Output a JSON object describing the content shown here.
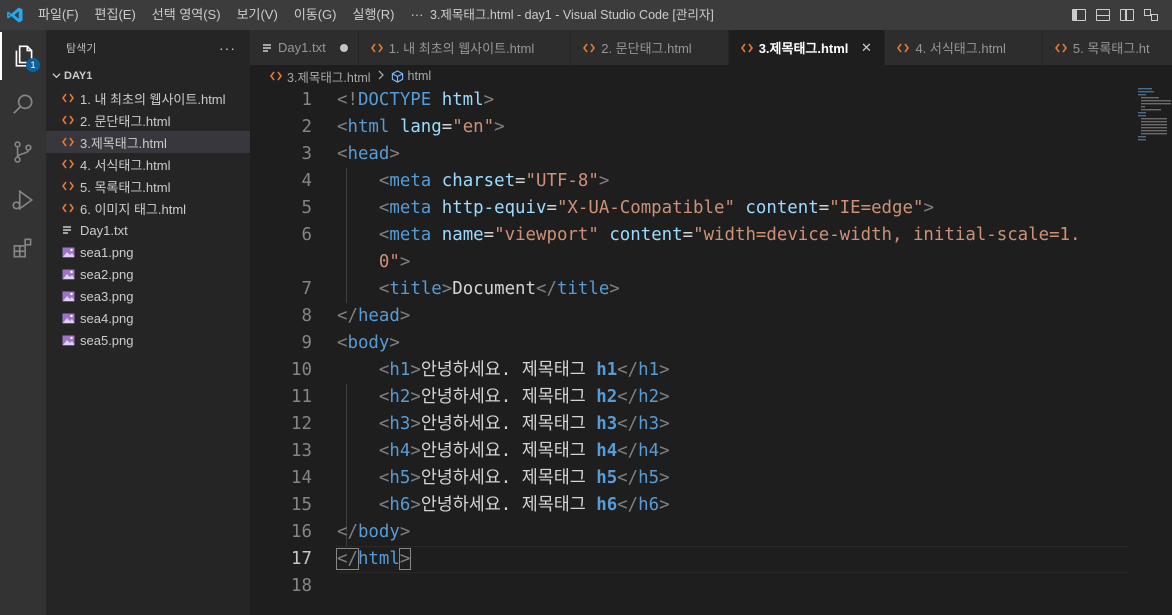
{
  "titlebar": {
    "menu": [
      "파일(F)",
      "편집(E)",
      "선택 영역(S)",
      "보기(V)",
      "이동(G)",
      "실행(R)",
      "···"
    ],
    "window_title": "3.제목태그.html - day1 - Visual Studio Code [관리자]"
  },
  "activity": {
    "explorer_badge": "1",
    "items": [
      "files-icon",
      "search-icon",
      "source-control-icon",
      "run-debug-icon",
      "extensions-icon"
    ]
  },
  "sidebar": {
    "title": "탐색기",
    "more": "···",
    "section": "DAY1",
    "files": [
      {
        "name": "1. 내 최초의 웹사이트.html",
        "type": "html"
      },
      {
        "name": "2. 문단태그.html",
        "type": "html"
      },
      {
        "name": "3.제목태그.html",
        "type": "html",
        "selected": true
      },
      {
        "name": "4. 서식태그.html",
        "type": "html"
      },
      {
        "name": "5. 목록태그.html",
        "type": "html"
      },
      {
        "name": "6. 이미지 태그.html",
        "type": "html"
      },
      {
        "name": "Day1.txt",
        "type": "txt"
      },
      {
        "name": "sea1.png",
        "type": "png"
      },
      {
        "name": "sea2.png",
        "type": "png"
      },
      {
        "name": "sea3.png",
        "type": "png"
      },
      {
        "name": "sea4.png",
        "type": "png"
      },
      {
        "name": "sea5.png",
        "type": "png"
      }
    ]
  },
  "tabs": [
    {
      "label": "Day1.txt",
      "type": "txt",
      "dirty": true
    },
    {
      "label": "1. 내 최초의 웹사이트.html",
      "type": "html"
    },
    {
      "label": "2. 문단태그.html",
      "type": "html"
    },
    {
      "label": "3.제목태그.html",
      "type": "html",
      "active": true,
      "close": "✕"
    },
    {
      "label": "4. 서식태그.html",
      "type": "html"
    },
    {
      "label": "5. 목록태그.ht",
      "type": "html"
    }
  ],
  "breadcrumb": {
    "file": "3.제목태그.html",
    "symbol": "html"
  },
  "editor": {
    "current_line": 17,
    "line_numbers": [
      "1",
      "2",
      "3",
      "4",
      "5",
      "6",
      "",
      "7",
      "8",
      "9",
      "10",
      "11",
      "12",
      "13",
      "14",
      "15",
      "16",
      "17",
      "18"
    ],
    "lines": [
      [
        [
          "p",
          "<!"
        ],
        [
          "t",
          "DOCTYPE"
        ],
        [
          "x",
          " "
        ],
        [
          "a",
          "html"
        ],
        [
          "p",
          ">"
        ]
      ],
      [
        [
          "p",
          "<"
        ],
        [
          "t",
          "html"
        ],
        [
          "x",
          " "
        ],
        [
          "a",
          "lang"
        ],
        [
          "x",
          "="
        ],
        [
          "s",
          "\"en\""
        ],
        [
          "p",
          ">"
        ]
      ],
      [
        [
          "p",
          "<"
        ],
        [
          "t",
          "head"
        ],
        [
          "p",
          ">"
        ]
      ],
      [
        [
          "x",
          "    "
        ],
        [
          "p",
          "<"
        ],
        [
          "t",
          "meta"
        ],
        [
          "x",
          " "
        ],
        [
          "a",
          "charset"
        ],
        [
          "x",
          "="
        ],
        [
          "s",
          "\"UTF-8\""
        ],
        [
          "p",
          ">"
        ]
      ],
      [
        [
          "x",
          "    "
        ],
        [
          "p",
          "<"
        ],
        [
          "t",
          "meta"
        ],
        [
          "x",
          " "
        ],
        [
          "a",
          "http-equiv"
        ],
        [
          "x",
          "="
        ],
        [
          "s",
          "\"X-UA-Compatible\""
        ],
        [
          "x",
          " "
        ],
        [
          "a",
          "content"
        ],
        [
          "x",
          "="
        ],
        [
          "s",
          "\"IE=edge\""
        ],
        [
          "p",
          ">"
        ]
      ],
      [
        [
          "x",
          "    "
        ],
        [
          "p",
          "<"
        ],
        [
          "t",
          "meta"
        ],
        [
          "x",
          " "
        ],
        [
          "a",
          "name"
        ],
        [
          "x",
          "="
        ],
        [
          "s",
          "\"viewport\""
        ],
        [
          "x",
          " "
        ],
        [
          "a",
          "content"
        ],
        [
          "x",
          "="
        ],
        [
          "s",
          "\"width=device-width, initial-scale=1."
        ]
      ],
      [
        [
          "x",
          "    "
        ],
        [
          "s",
          "0\""
        ],
        [
          "p",
          ">"
        ]
      ],
      [
        [
          "x",
          "    "
        ],
        [
          "p",
          "<"
        ],
        [
          "t",
          "title"
        ],
        [
          "p",
          ">"
        ],
        [
          "x",
          "Document"
        ],
        [
          "p",
          "</"
        ],
        [
          "t",
          "title"
        ],
        [
          "p",
          ">"
        ]
      ],
      [
        [
          "p",
          "</"
        ],
        [
          "t",
          "head"
        ],
        [
          "p",
          ">"
        ]
      ],
      [
        [
          "p",
          "<"
        ],
        [
          "t",
          "body"
        ],
        [
          "p",
          ">"
        ]
      ],
      [
        [
          "x",
          "    "
        ],
        [
          "p",
          "<"
        ],
        [
          "t",
          "h1"
        ],
        [
          "p",
          ">"
        ],
        [
          "x",
          "안녕하세요. 제목태그 "
        ],
        [
          "b",
          "h1"
        ],
        [
          "p",
          "</"
        ],
        [
          "t",
          "h1"
        ],
        [
          "p",
          ">"
        ]
      ],
      [
        [
          "x",
          "    "
        ],
        [
          "p",
          "<"
        ],
        [
          "t",
          "h2"
        ],
        [
          "p",
          ">"
        ],
        [
          "x",
          "안녕하세요. 제목태그 "
        ],
        [
          "b",
          "h2"
        ],
        [
          "p",
          "</"
        ],
        [
          "t",
          "h2"
        ],
        [
          "p",
          ">"
        ]
      ],
      [
        [
          "x",
          "    "
        ],
        [
          "p",
          "<"
        ],
        [
          "t",
          "h3"
        ],
        [
          "p",
          ">"
        ],
        [
          "x",
          "안녕하세요. 제목태그 "
        ],
        [
          "b",
          "h3"
        ],
        [
          "p",
          "</"
        ],
        [
          "t",
          "h3"
        ],
        [
          "p",
          ">"
        ]
      ],
      [
        [
          "x",
          "    "
        ],
        [
          "p",
          "<"
        ],
        [
          "t",
          "h4"
        ],
        [
          "p",
          ">"
        ],
        [
          "x",
          "안녕하세요. 제목태그 "
        ],
        [
          "b",
          "h4"
        ],
        [
          "p",
          "</"
        ],
        [
          "t",
          "h4"
        ],
        [
          "p",
          ">"
        ]
      ],
      [
        [
          "x",
          "    "
        ],
        [
          "p",
          "<"
        ],
        [
          "t",
          "h5"
        ],
        [
          "p",
          ">"
        ],
        [
          "x",
          "안녕하세요. 제목태그 "
        ],
        [
          "b",
          "h5"
        ],
        [
          "p",
          "</"
        ],
        [
          "t",
          "h5"
        ],
        [
          "p",
          ">"
        ]
      ],
      [
        [
          "x",
          "    "
        ],
        [
          "p",
          "<"
        ],
        [
          "t",
          "h6"
        ],
        [
          "p",
          ">"
        ],
        [
          "x",
          "안녕하세요. 제목태그 "
        ],
        [
          "b",
          "h6"
        ],
        [
          "p",
          "</"
        ],
        [
          "t",
          "h6"
        ],
        [
          "p",
          ">"
        ]
      ],
      [
        [
          "p",
          "</"
        ],
        [
          "t",
          "body"
        ],
        [
          "p",
          ">"
        ]
      ],
      [
        [
          "p",
          "</"
        ],
        [
          "t",
          "html"
        ],
        [
          "p",
          ">"
        ]
      ],
      [
        [
          "x",
          ""
        ]
      ]
    ]
  },
  "colors": {
    "accent": "#0e639c",
    "html_icon": "#e37933",
    "png_icon": "#a074c4"
  }
}
